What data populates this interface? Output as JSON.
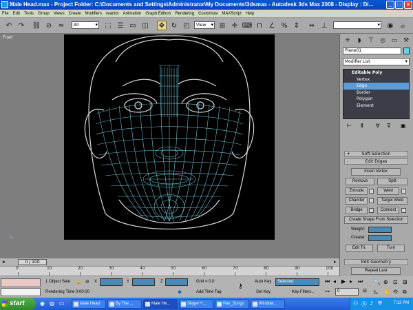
{
  "window": {
    "title": "Male Head.max    - Project Folder: C:\\Documents and Settings\\Administrator\\My Documents\\3dsmax    - Autodesk 3ds Max 2008     - Display : Di..."
  },
  "menu": [
    "File",
    "Edit",
    "Tools",
    "Group",
    "Views",
    "Create",
    "Modifiers",
    "reactor",
    "Animation",
    "Graph Editors",
    "Rendering",
    "Customize",
    "MAXScript",
    "Help"
  ],
  "toolbar": {
    "selection_filter": "All",
    "ref_coord": "View"
  },
  "viewport": {
    "label": "Front"
  },
  "command_panel": {
    "object_name": "Plane01",
    "modifier_list": "Modifier List",
    "stack": {
      "top": "Editable Poly",
      "subs": [
        "Vertex",
        "Edge",
        "Border",
        "Polygon",
        "Element"
      ],
      "selected": "Edge"
    },
    "rollouts": {
      "soft_selection": "Soft Selection",
      "edit_edges": "Edit Edges",
      "edit_geometry": "Edit Geometry"
    },
    "buttons": {
      "insert_vertex": "Insert Vertex",
      "remove": "Remove",
      "split": "Split",
      "extrude": "Extrude",
      "weld": "Weld",
      "chamfer": "Chamfer",
      "target_weld": "Target Weld",
      "bridge": "Bridge",
      "connect": "Connect",
      "create_shape": "Create Shape From Selection",
      "edit_tri": "Edit Tri.",
      "turn": "Turn",
      "repeat_last": "Repeat Last"
    },
    "weight_label": "Weight:",
    "crease_label": "Crease:"
  },
  "timeline": {
    "frame_display": "0 / 100",
    "ticks": [
      "0",
      "10",
      "20",
      "30",
      "40",
      "50",
      "60",
      "70",
      "80",
      "90",
      "100"
    ]
  },
  "status": {
    "selection_info": "1 Object Sele",
    "x_label": "X",
    "y_label": "Y",
    "z_label": "Z",
    "grid": "Grid = 0.0",
    "rendering_time": "Rendering Time  0:00:00",
    "add_time_tag": "Add Time Tag",
    "auto_key": "Auto Key",
    "set_key": "Set Key",
    "key_mode": "Selected",
    "key_filters": "Key Filters...",
    "frame_field": "0"
  },
  "taskbar": {
    "start": "start",
    "tasks": [
      "Male Head",
      "By The ...",
      "Male He...",
      "Skype™...",
      "Pav_Songs",
      "Window..."
    ],
    "clock": "7:12 PM"
  },
  "colors": {
    "wireframe": "#7fd8ea",
    "outline": "#cfcfcf",
    "selected_stack": "#5d9bd6"
  }
}
